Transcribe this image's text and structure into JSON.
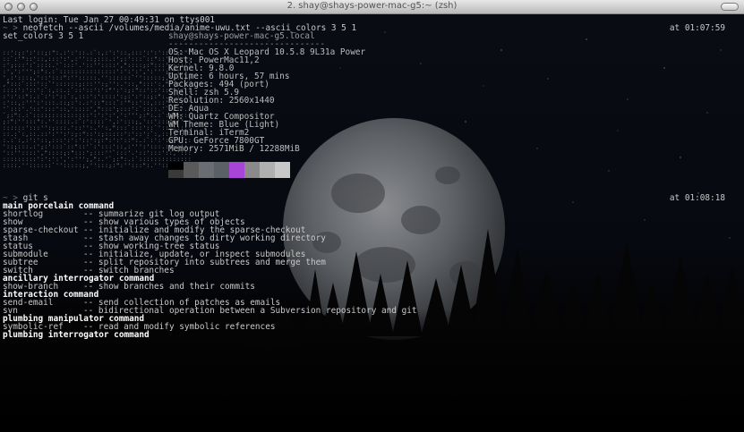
{
  "window": {
    "title": "2. shay@shays-power-mac-g5:~ (zsh)"
  },
  "terminal": {
    "last_login": "Last login: Tue Jan 27 00:49:31 on ttys001",
    "prompt": "~ >",
    "cmd1": "neofetch --ascii /volumes/media/anime-uwu.txt --ascii_colors 3 5 1",
    "cmd1_wrap": "set_colors 3 5 1",
    "time1": "at 01:07:59",
    "cmd2": "git s",
    "time2": "at 01:08:18"
  },
  "neofetch": {
    "host_line": "shay@shays-power-mac-g5.local",
    "separator": "-------------------------------",
    "lines": [
      "OS: Mac OS X Leopard 10.5.8 9L31a Power",
      "Host: PowerMac11,2",
      "Kernel: 9.8.0",
      "Uptime: 6 hours, 57 mins",
      "Packages: 494 (port)",
      "Shell: zsh 5.9",
      "Resolution: 2560x1440",
      "DE: Aqua",
      "WM: Quartz Compositor",
      "WM Theme: Blue (Light)",
      "Terminal: iTerm2",
      "GPU: GeForce 7800GT",
      "Memory: 2571MiB / 12288MiB"
    ],
    "colors_top": [
      "#000000",
      "#000000",
      "#000000",
      "#000000",
      "#000000",
      "#000000",
      "#000000",
      "#000000"
    ],
    "colors_bottom": [
      "#3a3a3a",
      "#5a5a5a",
      "#6a6e72",
      "#5b5f66",
      "#a845d8",
      "#8a8a8a",
      "#b0b0b0",
      "#c8c8c8"
    ]
  },
  "git": {
    "sections": [
      {
        "header": "main porcelain command",
        "rows": [
          {
            "cmd": "shortlog",
            "desc": "-- summarize git log output"
          },
          {
            "cmd": "show",
            "desc": "-- show various types of objects"
          },
          {
            "cmd": "sparse-checkout",
            "desc": "-- initialize and modify the sparse-checkout"
          },
          {
            "cmd": "stash",
            "desc": "-- stash away changes to dirty working directory"
          },
          {
            "cmd": "status",
            "desc": "-- show working-tree status"
          },
          {
            "cmd": "submodule",
            "desc": "-- initialize, update, or inspect submodules"
          },
          {
            "cmd": "subtree",
            "desc": "-- split repository into subtrees and merge them"
          },
          {
            "cmd": "switch",
            "desc": "-- switch branches"
          }
        ]
      },
      {
        "header": "ancillary interrogator command",
        "rows": [
          {
            "cmd": "show-branch",
            "desc": "-- show branches and their commits"
          }
        ]
      },
      {
        "header": "interaction command",
        "rows": [
          {
            "cmd": "send-email",
            "desc": "-- send collection of patches as emails"
          },
          {
            "cmd": "svn",
            "desc": "-- bidirectional operation between a Subversion repository and git"
          }
        ]
      },
      {
        "header": "plumbing manipulator command",
        "rows": [
          {
            "cmd": "symbolic-ref",
            "desc": "-- read and modify symbolic references"
          }
        ]
      },
      {
        "header": "plumbing interrogator command",
        "rows": []
      }
    ]
  },
  "colors": {
    "background": "#05060a",
    "text": "#c9c9c9",
    "header": "#ffffff",
    "prompt": "#6e6e6e"
  }
}
